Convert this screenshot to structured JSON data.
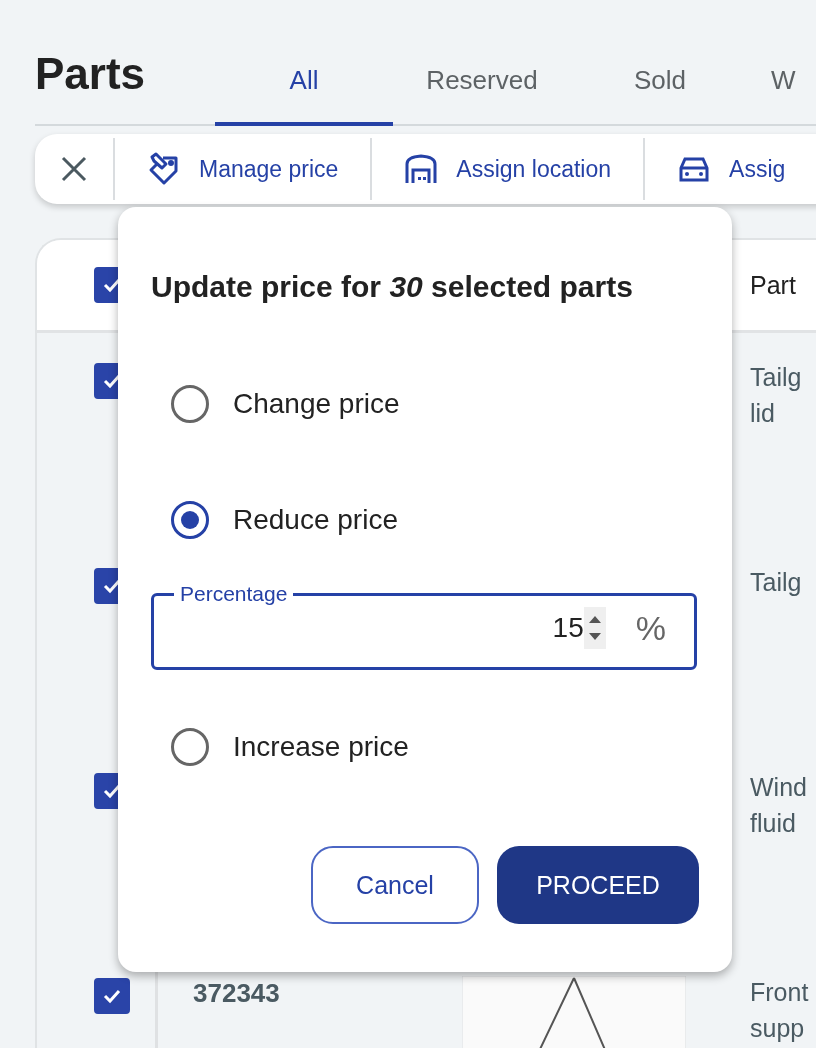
{
  "page": {
    "title": "Parts"
  },
  "tabs": [
    {
      "label": "All",
      "selected": true
    },
    {
      "label": "Reserved",
      "selected": false
    },
    {
      "label": "Sold",
      "selected": false
    },
    {
      "label": "W",
      "selected": false
    }
  ],
  "toolbar": {
    "actions": [
      {
        "kind": "price",
        "label": "Manage price"
      },
      {
        "kind": "location",
        "label": "Assign location"
      },
      {
        "kind": "vehicle",
        "label": "Assig"
      }
    ]
  },
  "table": {
    "header": {
      "checked": true,
      "part": "Part"
    },
    "rows": [
      {
        "checked": true,
        "part": [
          "Tailg",
          "lid"
        ]
      },
      {
        "checked": true,
        "part": [
          "Tailg"
        ]
      },
      {
        "checked": true,
        "part": [
          "Wind",
          "fluid"
        ]
      },
      {
        "checked": true,
        "id": "372343",
        "image": true,
        "part": [
          "Front",
          "supp"
        ]
      }
    ]
  },
  "popover": {
    "title": "Update price for *30* selected parts",
    "options": [
      {
        "label": "Change price",
        "selected": false
      },
      {
        "label": "Reduce price",
        "selected": true,
        "field": {
          "label": "Percentage",
          "value": "15",
          "unit": "%"
        }
      },
      {
        "label": "Increase price",
        "selected": false
      }
    ],
    "buttons": [
      {
        "kind": "secondary",
        "label": "Cancel"
      },
      {
        "kind": "primary",
        "label": "PROCEED"
      }
    ]
  }
}
